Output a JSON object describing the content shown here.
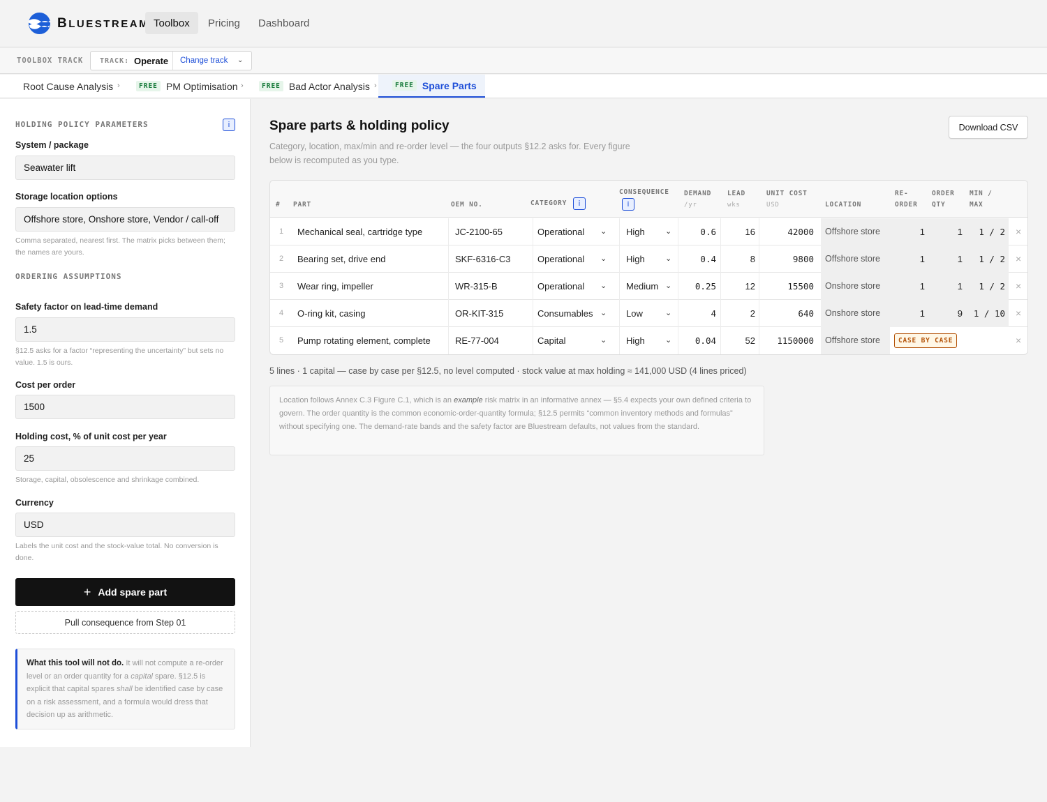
{
  "brand": {
    "name": "Bluestream",
    "first": "B",
    "rest": "luestream"
  },
  "nav": {
    "items": [
      "Toolbox",
      "Pricing",
      "Dashboard"
    ]
  },
  "track": {
    "label": "TOOLBOX TRACK",
    "key": "TRACK:",
    "value": "Operate",
    "change": "Change track"
  },
  "crumbs": {
    "free": "FREE",
    "items": [
      "Root Cause Analysis",
      "PM Optimisation",
      "Bad Actor Analysis",
      "Spare Parts"
    ]
  },
  "sidebar": {
    "holding_head": "HOLDING POLICY PARAMETERS",
    "info": "i",
    "system_label": "System / package",
    "system_value": "Seawater lift",
    "storage_label": "Storage location options",
    "storage_value": "Offshore store, Onshore store, Vendor / call-off",
    "storage_help": "Comma separated, nearest first. The matrix picks between them; the names are yours.",
    "ordering_head": "ORDERING ASSUMPTIONS",
    "safety_label": "Safety factor on lead-time demand",
    "safety_value": "1.5",
    "safety_help": "§12.5 asks for a factor “representing the uncertainty” but sets no value. 1.5 is ours.",
    "cost_label": "Cost per order",
    "cost_value": "1500",
    "holding_label": "Holding cost, % of unit cost per year",
    "holding_value": "25",
    "holding_help": "Storage, capital, obsolescence and shrinkage combined.",
    "currency_label": "Currency",
    "currency_value": "USD",
    "currency_help": "Labels the unit cost and the stock-value total. No conversion is done.",
    "add_button": "Add spare part",
    "pull_button": "Pull consequence from Step 01",
    "note_title": "What this tool will not do.",
    "note_a": " It will not compute a re-order level or an order quantity for a ",
    "note_em1": "capital",
    "note_b": " spare. §12.5 is explicit that capital spares ",
    "note_em2": "shall",
    "note_c": " be identified case by case on a risk assessment, and a formula would dress that decision up as arithmetic."
  },
  "main": {
    "title": "Spare parts & holding policy",
    "subtitle": "Category, location, max/min and re-order level — the four outputs §12.2 asks for. Every figure below is recomputed as you type.",
    "download": "Download CSV",
    "headers": {
      "idx": "#",
      "part": "PART",
      "oem": "OEM NO.",
      "category": "CATEGORY",
      "consequence": "CONSEQUENCE",
      "demand": "DEMAND",
      "demand_unit": "/yr",
      "lead": "LEAD",
      "lead_unit": "wks",
      "unit_cost": "UNIT COST",
      "unit_cost_unit": "USD",
      "location": "LOCATION",
      "reorder_1": "RE-",
      "reorder_2": "ORDER",
      "orderqty_1": "ORDER",
      "orderqty_2": "QTY",
      "minmax_1": "MIN /",
      "minmax_2": "MAX"
    },
    "rows": [
      {
        "idx": "1",
        "part": "Mechanical seal, cartridge type",
        "oem": "JC-2100-65",
        "category": "Operational",
        "consequence": "High",
        "demand": "0.6",
        "lead": "16",
        "unit_cost": "42000",
        "location": "Offshore store",
        "reorder": "1",
        "order_qty": "1",
        "minmax": "1 / 2"
      },
      {
        "idx": "2",
        "part": "Bearing set, drive end",
        "oem": "SKF-6316-C3",
        "category": "Operational",
        "consequence": "High",
        "demand": "0.4",
        "lead": "8",
        "unit_cost": "9800",
        "location": "Offshore store",
        "reorder": "1",
        "order_qty": "1",
        "minmax": "1 / 2"
      },
      {
        "idx": "3",
        "part": "Wear ring, impeller",
        "oem": "WR-315-B",
        "category": "Operational",
        "consequence": "Medium",
        "demand": "0.25",
        "lead": "12",
        "unit_cost": "15500",
        "location": "Onshore store",
        "reorder": "1",
        "order_qty": "1",
        "minmax": "1 / 2"
      },
      {
        "idx": "4",
        "part": "O-ring kit, casing",
        "oem": "OR-KIT-315",
        "category": "Consumables",
        "consequence": "Low",
        "demand": "4",
        "lead": "2",
        "unit_cost": "640",
        "location": "Onshore store",
        "reorder": "1",
        "order_qty": "9",
        "minmax": "1 / 10"
      },
      {
        "idx": "5",
        "part": "Pump rotating element, complete",
        "oem": "RE-77-004",
        "category": "Capital",
        "consequence": "High",
        "demand": "0.04",
        "lead": "52",
        "unit_cost": "1150000",
        "location": "Offshore store",
        "badge": "CASE BY CASE"
      }
    ],
    "summary": "5 lines · 1 capital — case by case per §12.5, no level computed · stock value at max holding ≈ 141,000 USD (4 lines priced)",
    "note_a": "Location follows Annex C.3 Figure C.1, which is an ",
    "note_em": "example",
    "note_b": " risk matrix in an informative annex — §5.4 expects your own defined criteria to govern. The order quantity is the common economic-order-quantity formula; §12.5 permits “common inventory methods and formulas” without specifying one. The demand-rate bands and the safety factor are Bluestream defaults, not values from the standard."
  },
  "colors": {
    "accent": "#1d4ed8",
    "free": "#177a3a",
    "capital_badge": "#b45309"
  },
  "icons": [
    "bluestream-logo-icon",
    "chevron-right-icon",
    "chevron-down-icon",
    "plus-icon",
    "close-icon",
    "info-icon"
  ]
}
